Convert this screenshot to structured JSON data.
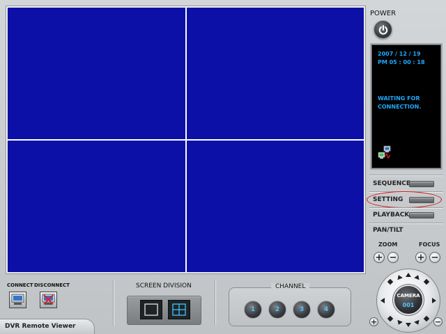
{
  "app": {
    "title": "DVR Remote Viewer"
  },
  "power": {
    "label": "POWER",
    "icon": "power-icon"
  },
  "status": {
    "date": "2007 / 12 / 19",
    "time": "PM 05 : 00 : 18",
    "message_line1": "WAITING FOR",
    "message_line2": "CONNECTION.",
    "icon": "network-disconnected-icon"
  },
  "side_menu": {
    "sequence": "SEQUENCE",
    "setting": "SETTING",
    "playback": "PLAYBACK",
    "pan_tilt": "PAN/TILT",
    "zoom": "ZOOM",
    "focus": "FOCUS",
    "plus_symbol": "+",
    "minus_symbol": "−"
  },
  "connection": {
    "connect_label": "CONNECT",
    "disconnect_label": "DISCONNECT"
  },
  "screen_division": {
    "label": "SCREEN DIVISION",
    "options": [
      "single-view-icon",
      "quad-view-icon"
    ],
    "selected": "quad-view-icon"
  },
  "channel": {
    "label": "CHANNEL",
    "buttons": [
      "1",
      "2",
      "3",
      "4"
    ]
  },
  "camera": {
    "label": "CAMERA",
    "number": "001"
  },
  "colors": {
    "video_background": "#0c10a6",
    "status_text": "#1ea9ff",
    "highlight_ring": "#d11414",
    "channel_text": "#54c6ff"
  }
}
